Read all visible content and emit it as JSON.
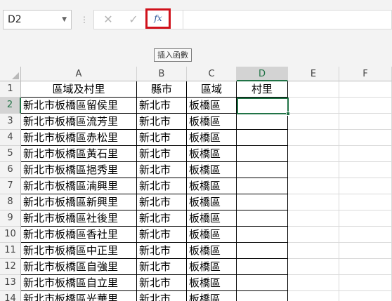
{
  "formula_bar": {
    "name_box": "D2",
    "dropdown_glyph": "▼",
    "separator_glyph": "⋮",
    "cancel_glyph": "✕",
    "enter_glyph": "✓",
    "fx_label": "fx",
    "formula_value": "",
    "tooltip": "插入函數"
  },
  "selection": {
    "row": 2,
    "col": "D"
  },
  "columns": [
    "A",
    "B",
    "C",
    "D",
    "E",
    "F"
  ],
  "rows": [
    [
      "區域及村里",
      "縣市",
      "區域",
      "村里"
    ],
    [
      "新北市板橋區留侯里",
      "新北市",
      "板橋區",
      ""
    ],
    [
      "新北市板橋區流芳里",
      "新北市",
      "板橋區",
      ""
    ],
    [
      "新北市板橋區赤松里",
      "新北市",
      "板橋區",
      ""
    ],
    [
      "新北市板橋區黃石里",
      "新北市",
      "板橋區",
      ""
    ],
    [
      "新北市板橋區挹秀里",
      "新北市",
      "板橋區",
      ""
    ],
    [
      "新北市板橋區湳興里",
      "新北市",
      "板橋區",
      ""
    ],
    [
      "新北市板橋區新興里",
      "新北市",
      "板橋區",
      ""
    ],
    [
      "新北市板橋區社後里",
      "新北市",
      "板橋區",
      ""
    ],
    [
      "新北市板橋區香社里",
      "新北市",
      "板橋區",
      ""
    ],
    [
      "新北市板橋區中正里",
      "新北市",
      "板橋區",
      ""
    ],
    [
      "新北市板橋區自強里",
      "新北市",
      "板橋區",
      ""
    ],
    [
      "新北市板橋區自立里",
      "新北市",
      "板橋區",
      ""
    ],
    [
      "新北市板橋區光華里",
      "新北市",
      "板橋區",
      ""
    ]
  ],
  "accent_color": "#217346",
  "highlight_color": "#d0111b"
}
